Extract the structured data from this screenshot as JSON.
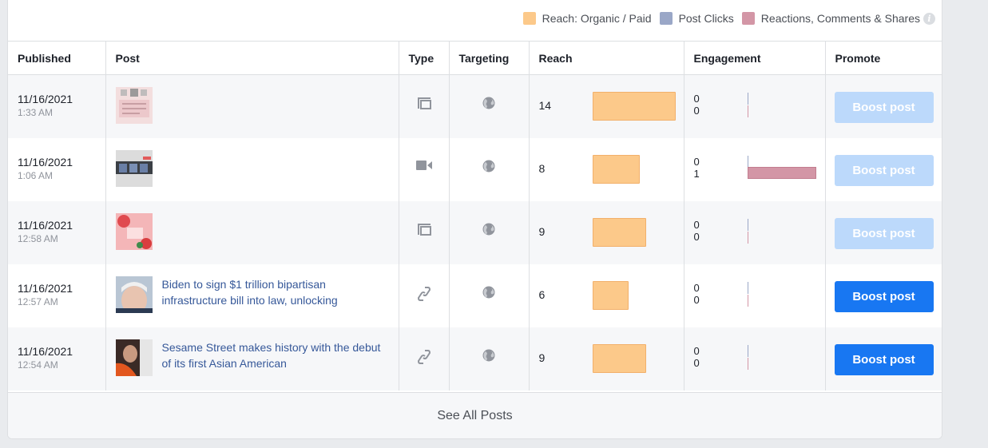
{
  "legend": {
    "items": [
      {
        "label": "Reach: Organic / Paid",
        "color": "#fcc98a"
      },
      {
        "label": "Post Clicks",
        "color": "#9aa7c7"
      },
      {
        "label": "Reactions, Comments & Shares",
        "color": "#d396a6"
      }
    ],
    "info_icon": "i"
  },
  "columns": [
    "Published",
    "Post",
    "Type",
    "Targeting",
    "Reach",
    "Engagement",
    "Promote"
  ],
  "rows": [
    {
      "date": "11/16/2021",
      "time": "1:33 AM",
      "post_text": "",
      "type_icon": "album-icon",
      "reach": 14,
      "clicks": 0,
      "reactions": 0,
      "boost_label": "Boost post",
      "boost_enabled": false
    },
    {
      "date": "11/16/2021",
      "time": "1:06 AM",
      "post_text": "",
      "type_icon": "video-icon",
      "reach": 8,
      "clicks": 0,
      "reactions": 1,
      "boost_label": "Boost post",
      "boost_enabled": false
    },
    {
      "date": "11/16/2021",
      "time": "12:58 AM",
      "post_text": "",
      "type_icon": "album-icon",
      "reach": 9,
      "clicks": 0,
      "reactions": 0,
      "boost_label": "Boost post",
      "boost_enabled": false
    },
    {
      "date": "11/16/2021",
      "time": "12:57 AM",
      "post_text": "Biden to sign $1 trillion bipartisan infrastructure bill into law, unlocking",
      "type_icon": "link-icon",
      "reach": 6,
      "clicks": 0,
      "reactions": 0,
      "boost_label": "Boost post",
      "boost_enabled": true
    },
    {
      "date": "11/16/2021",
      "time": "12:54 AM",
      "post_text": "Sesame Street makes history with the debut of its first Asian American",
      "type_icon": "link-icon",
      "reach": 9,
      "clicks": 0,
      "reactions": 0,
      "boost_label": "Boost post",
      "boost_enabled": true
    }
  ],
  "footer": {
    "label": "See All Posts"
  }
}
